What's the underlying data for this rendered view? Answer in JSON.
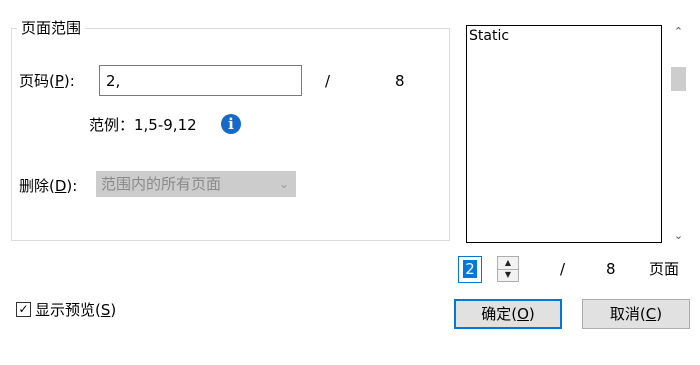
{
  "page_range": {
    "legend": "页面范围",
    "page_label_prefix": "页码(",
    "page_label_key": "P",
    "page_label_suffix": "):",
    "page_input_value": "2,",
    "slash": "/",
    "total_pages": "8",
    "example_text": "范例：1,5-9,12",
    "delete_label_prefix": "删除(",
    "delete_label_key": "D",
    "delete_label_suffix": "):",
    "delete_option_selected": "范围内的所有页面"
  },
  "preview": {
    "text": "Static",
    "current_page": "2",
    "slash": "/",
    "total_pages": "8",
    "pages_label": "页面"
  },
  "show_preview": {
    "checked": true,
    "label_prefix": "显示预览(",
    "label_key": "S",
    "label_suffix": ")"
  },
  "buttons": {
    "ok_prefix": "确定(",
    "ok_key": "O",
    "ok_suffix": ")",
    "cancel_prefix": "取消(",
    "cancel_key": "C",
    "cancel_suffix": ")"
  }
}
